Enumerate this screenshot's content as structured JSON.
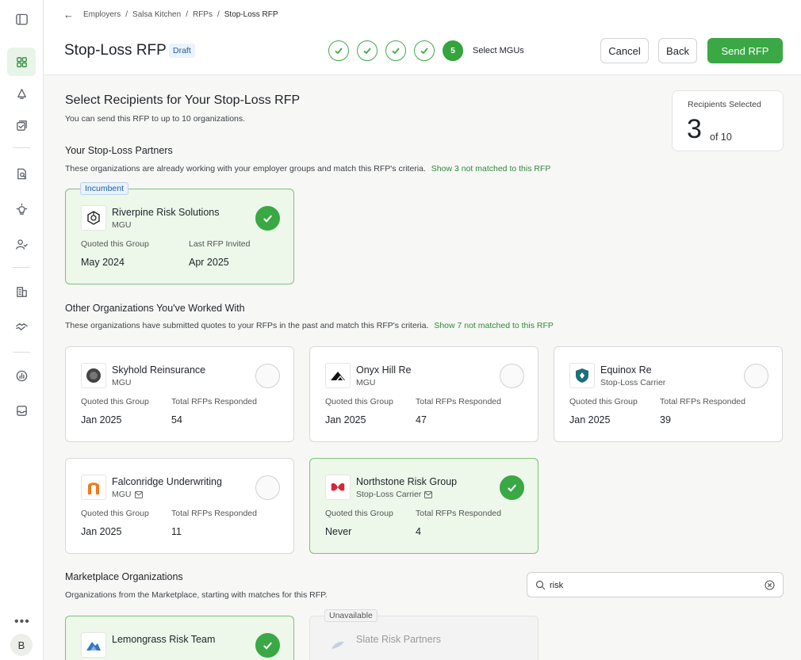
{
  "breadcrumb": [
    "Employers",
    "Salsa Kitchen",
    "RFPs",
    "Stop-Loss RFP"
  ],
  "header": {
    "title": "Stop-Loss RFP",
    "status_badge": "Draft",
    "current_step": "5",
    "current_step_label": "Select MGUs",
    "cancel_label": "Cancel",
    "back_label": "Back",
    "send_label": "Send RFP"
  },
  "main": {
    "title": "Select Recipients for Your Stop-Loss RFP",
    "subtitle": "You can send this RFP to up to 10 organizations.",
    "counter": {
      "label": "Recipients Selected",
      "count": "3",
      "of": "of 10"
    }
  },
  "partners": {
    "title": "Your Stop-Loss Partners",
    "desc": "These organizations are already working with your employer groups and match this RFP's criteria.",
    "link": "Show 3 not matched to this RFP",
    "cards": [
      {
        "badge": "Incumbent",
        "name": "Riverpine Risk Solutions",
        "type": "MGU",
        "k1": "Quoted this Group",
        "v1": "May 2024",
        "k2": "Last RFP Invited",
        "v2": "Apr 2025",
        "selected": true
      }
    ]
  },
  "others": {
    "title": "Other Organizations You've Worked With",
    "desc": "These organizations have submitted quotes to your RFPs in the past and match this RFP's criteria.",
    "link": "Show 7 not matched to this RFP",
    "cards": [
      {
        "name": "Skyhold Reinsurance",
        "type": "MGU",
        "k1": "Quoted this Group",
        "v1": "Jan 2025",
        "k2": "Total RFPs Responded",
        "v2": "54",
        "selected": false
      },
      {
        "name": "Onyx Hill Re",
        "type": "MGU",
        "k1": "Quoted this Group",
        "v1": "Jan 2025",
        "k2": "Total RFPs Responded",
        "v2": "47",
        "selected": false
      },
      {
        "name": "Equinox Re",
        "type": "Stop-Loss Carrier",
        "k1": "Quoted this Group",
        "v1": "Jan 2025",
        "k2": "Total RFPs Responded",
        "v2": "39",
        "selected": false
      },
      {
        "name": "Falconridge Underwriting",
        "type": "MGU",
        "k1": "Quoted this Group",
        "v1": "Jan 2025",
        "k2": "Total RFPs Responded",
        "v2": "11",
        "selected": false
      },
      {
        "name": "Northstone Risk Group",
        "type": "Stop-Loss Carrier",
        "k1": "Quoted this Group",
        "v1": "Never",
        "k2": "Total RFPs Responded",
        "v2": "4",
        "selected": true
      }
    ]
  },
  "marketplace": {
    "title": "Marketplace Organizations",
    "desc": "Organizations from the Marketplace, starting with matches for this RFP.",
    "search_value": "risk",
    "cards": [
      {
        "name": "Lemongrass Risk Team",
        "selected": true
      },
      {
        "badge": "Unavailable",
        "name": "Slate Risk Partners",
        "selected": false
      }
    ]
  },
  "user": {
    "initial": "B"
  },
  "colors": {
    "accent": "#3aa845",
    "selected_bg": "#edf7ea",
    "badge_blue": "#1f5fa8"
  }
}
